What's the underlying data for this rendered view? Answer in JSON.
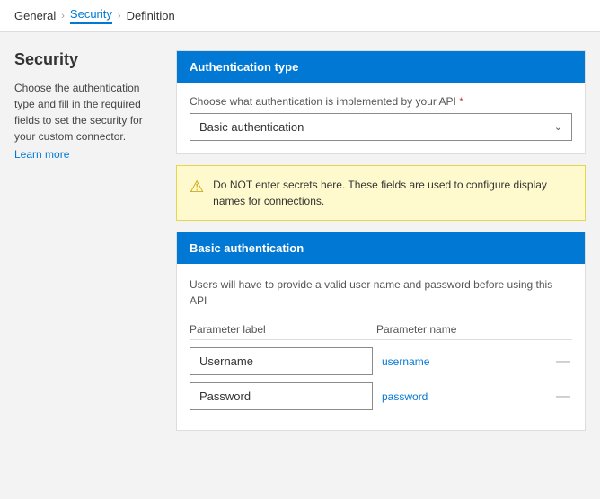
{
  "breadcrumb": {
    "items": [
      {
        "label": "General",
        "active": false
      },
      {
        "label": "Security",
        "active": true
      },
      {
        "label": "Definition",
        "active": false
      }
    ]
  },
  "sidebar": {
    "title": "Security",
    "description": "Choose the authentication type and fill in the required fields to set the security for your custom connector.",
    "link_label": "Learn more"
  },
  "auth_type_section": {
    "header": "Authentication type",
    "field_label": "Choose what authentication is implemented by your API",
    "required_marker": "*",
    "selected_value": "Basic authentication",
    "dropdown_arrow": "⌄"
  },
  "warning": {
    "icon": "⚠",
    "text": "Do NOT enter secrets here. These fields are used to configure display names for connections."
  },
  "basic_auth_section": {
    "header": "Basic authentication",
    "description": "Users will have to provide a valid user name and password before using this API",
    "col_label": "Parameter label",
    "col_name": "Parameter name",
    "rows": [
      {
        "label": "Username",
        "name": "username"
      },
      {
        "label": "Password",
        "name": "password"
      }
    ]
  }
}
